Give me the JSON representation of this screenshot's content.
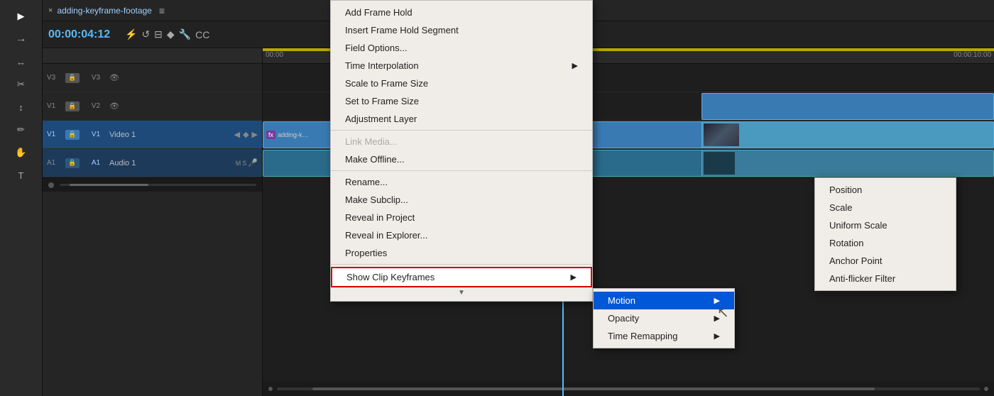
{
  "tab": {
    "close_label": "×",
    "title": "adding-keyframe-footage",
    "menu_icon": "≡"
  },
  "timecode": "00:00:04:12",
  "toolbar": {
    "icons": [
      "⚡",
      "↺",
      "⊟",
      "◆",
      "🔧",
      "CC"
    ]
  },
  "ruler": {
    "time_left": "00:00",
    "time_right": "00:00:10:00"
  },
  "tracks": [
    {
      "id": "V3",
      "label": "V3",
      "name": ""
    },
    {
      "id": "V2",
      "label": "V2",
      "name": ""
    },
    {
      "id": "V1",
      "label": "V1",
      "name": "Video 1"
    },
    {
      "id": "A1",
      "label": "A1",
      "name": "Audio 1"
    }
  ],
  "context_menu": {
    "items": [
      {
        "id": "add-frame-hold",
        "label": "Add Frame Hold",
        "disabled": false,
        "separator_after": false
      },
      {
        "id": "insert-frame-hold",
        "label": "Insert Frame Hold Segment",
        "disabled": false,
        "separator_after": false
      },
      {
        "id": "field-options",
        "label": "Field Options...",
        "disabled": false,
        "separator_after": false
      },
      {
        "id": "time-interpolation",
        "label": "Time Interpolation",
        "disabled": false,
        "has_arrow": true,
        "separator_after": false
      },
      {
        "id": "scale-to-frame",
        "label": "Scale to Frame Size",
        "disabled": false,
        "separator_after": false
      },
      {
        "id": "set-to-frame",
        "label": "Set to Frame Size",
        "disabled": false,
        "separator_after": false
      },
      {
        "id": "adjustment-layer",
        "label": "Adjustment Layer",
        "disabled": false,
        "separator_after": true
      },
      {
        "id": "link-media",
        "label": "Link Media...",
        "disabled": true,
        "separator_after": false
      },
      {
        "id": "make-offline",
        "label": "Make Offline...",
        "disabled": false,
        "separator_after": true
      },
      {
        "id": "rename",
        "label": "Rename...",
        "disabled": false,
        "separator_after": false
      },
      {
        "id": "make-subclip",
        "label": "Make Subclip...",
        "disabled": false,
        "separator_after": false
      },
      {
        "id": "reveal-project",
        "label": "Reveal in Project",
        "disabled": false,
        "separator_after": false
      },
      {
        "id": "reveal-explorer",
        "label": "Reveal in Explorer...",
        "disabled": false,
        "separator_after": false
      },
      {
        "id": "properties",
        "label": "Properties",
        "disabled": false,
        "separator_after": true
      },
      {
        "id": "show-clip-keyframes",
        "label": "Show Clip Keyframes",
        "disabled": false,
        "has_arrow": true,
        "highlighted": true,
        "separator_after": false
      },
      {
        "id": "scroll-down-arrow",
        "label": "▼",
        "disabled": false,
        "separator_after": false
      }
    ]
  },
  "submenu_keyframes": {
    "items": [
      {
        "id": "motion",
        "label": "Motion",
        "has_arrow": true
      },
      {
        "id": "opacity",
        "label": "Opacity",
        "has_arrow": true
      },
      {
        "id": "time-remapping",
        "label": "Time Remapping",
        "has_arrow": true
      }
    ]
  },
  "submenu_motion": {
    "items": [
      {
        "id": "position",
        "label": "Position"
      },
      {
        "id": "scale",
        "label": "Scale"
      },
      {
        "id": "uniform-scale",
        "label": "Uniform Scale"
      },
      {
        "id": "rotation",
        "label": "Rotation"
      },
      {
        "id": "anchor-point",
        "label": "Anchor Point"
      },
      {
        "id": "anti-flicker",
        "label": "Anti-flicker Filter"
      }
    ]
  },
  "colors": {
    "accent_blue": "#3a7ab3",
    "tab_blue": "#9ecfff",
    "highlight_red": "#cc0000"
  }
}
